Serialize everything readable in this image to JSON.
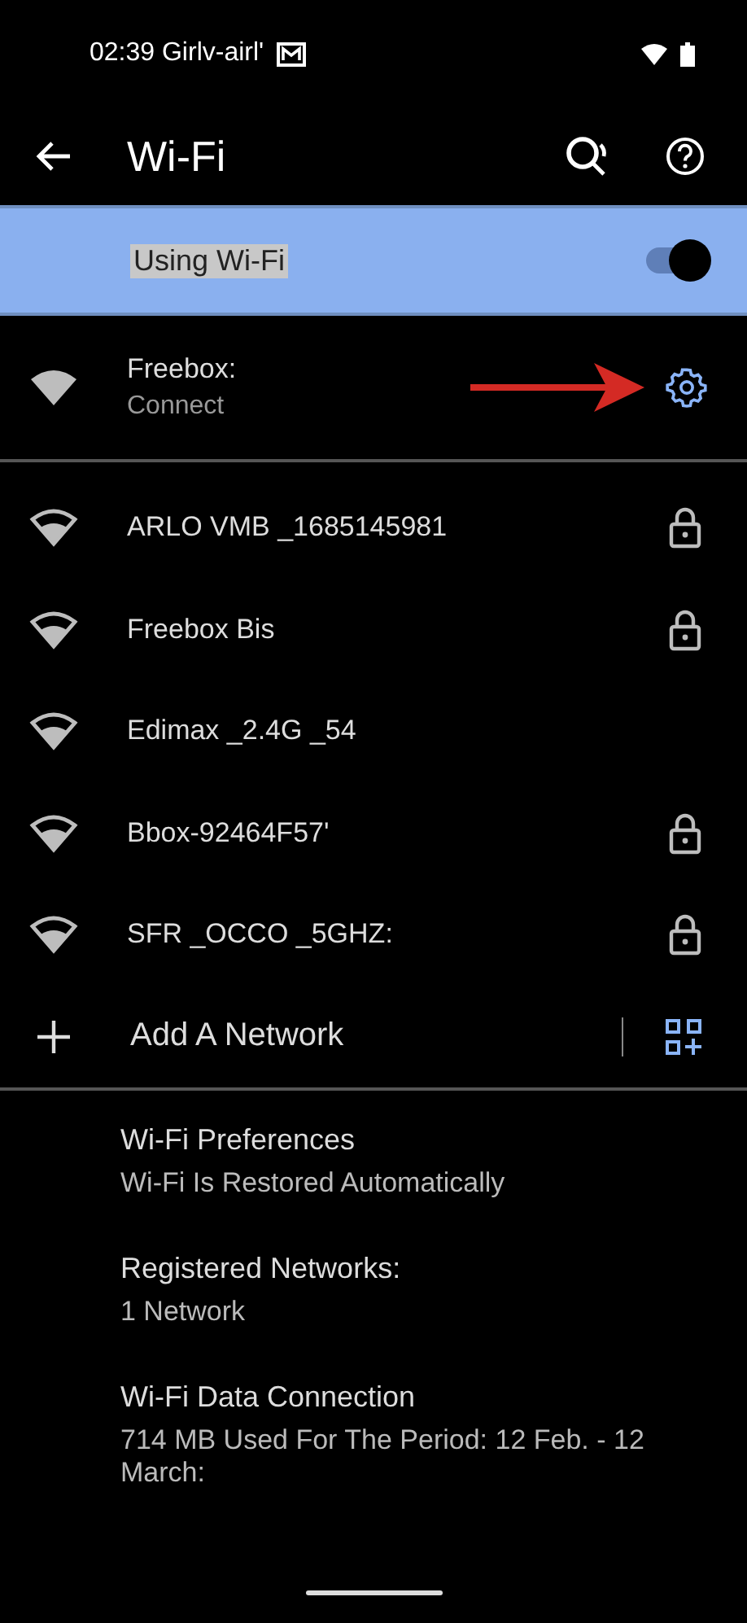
{
  "status_bar": {
    "time_text": "02:39 Girlv-airl'"
  },
  "toolbar": {
    "title": "Wi-Fi"
  },
  "master_switch": {
    "label": "Using Wi-Fi",
    "on": true
  },
  "connected": {
    "name": "Freebox:",
    "status": "Connect"
  },
  "networks": [
    {
      "name": "ARLO VMB _1685145981",
      "locked": true
    },
    {
      "name": "Freebox Bis",
      "locked": true
    },
    {
      "name": "Edimax _2.4G _54",
      "locked": false
    },
    {
      "name": "Bbox-92464F57'",
      "locked": true
    },
    {
      "name": "SFR _OCCO _5GHZ:",
      "locked": true
    }
  ],
  "add_network": {
    "label": "Add A Network"
  },
  "settings": [
    {
      "title": "Wi-Fi Preferences",
      "summary": "Wi-Fi Is Restored Automatically"
    },
    {
      "title": "Registered Networks:",
      "summary": "1 Network"
    },
    {
      "title": "Wi-Fi Data Connection",
      "summary": "714 MB Used For The Period: 12 Feb. - 12 March:"
    }
  ]
}
